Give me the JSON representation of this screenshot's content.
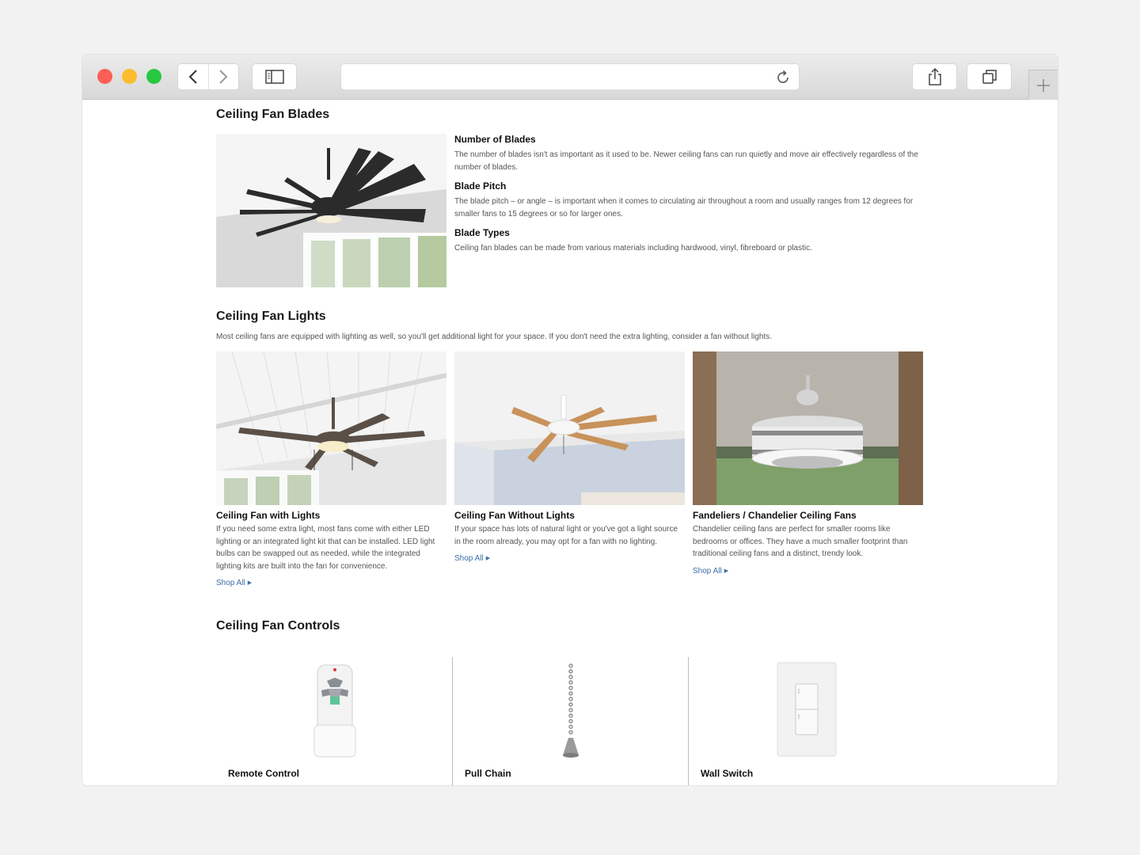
{
  "browser": {
    "url": ""
  },
  "blades": {
    "heading": "Ceiling Fan Blades",
    "items": [
      {
        "title": "Number of Blades",
        "text": "The number of blades isn't as important as it used to be. Newer ceiling fans can run quietly and move air effectively regardless of the number of blades."
      },
      {
        "title": "Blade Pitch",
        "text": "The blade pitch – or angle – is important when it comes to circulating air throughout a room and usually ranges from 12 degrees for smaller fans to 15 degrees or so for larger ones."
      },
      {
        "title": "Blade Types",
        "text": "Ceiling fan blades can be made from various materials including hardwood, vinyl, fibreboard or plastic."
      }
    ]
  },
  "lights": {
    "heading": "Ceiling Fan Lights",
    "intro": "Most ceiling fans are equipped with lighting as well, so you'll get additional light for your space. If you don't need the extra lighting, consider a fan without lights.",
    "cards": [
      {
        "title": "Ceiling Fan with Lights",
        "text": "If you need some extra light, most fans come with either LED lighting or an integrated light kit that can be installed. LED light bulbs can be swapped out as needed, while the integrated lighting kits are built into the fan for convenience.",
        "link": "Shop All"
      },
      {
        "title": "Ceiling Fan Without Lights",
        "text": "If your space has lots of natural light or you've got a light source in the room already, you may opt for a fan with no lighting.",
        "link": "Shop All"
      },
      {
        "title": "Fandeliers / Chandelier Ceiling Fans",
        "text": "Chandelier ceiling fans are perfect for smaller rooms like bedrooms or offices. They have a much smaller footprint than traditional ceiling fans and a distinct, trendy look.",
        "link": "Shop All"
      }
    ]
  },
  "controls": {
    "heading": "Ceiling Fan Controls",
    "items": [
      {
        "label": "Remote Control"
      },
      {
        "label": "Pull Chain"
      },
      {
        "label": "Wall Switch"
      }
    ]
  },
  "colors": {
    "link": "#3b6ea8",
    "heading": "#1a1a1a",
    "body": "#555555"
  }
}
